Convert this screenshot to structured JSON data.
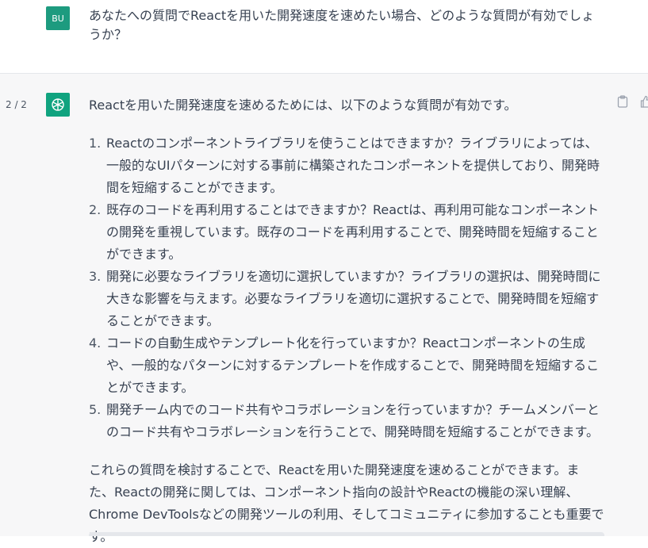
{
  "user": {
    "avatar_initials": "BU",
    "message": "あなたへの質問でReactを用いた開発速度を速めたい場合、どのような質問が有効でしょうか？"
  },
  "assistant": {
    "pager": "2 / 2",
    "intro": "Reactを用いた開発速度を速めるためには、以下のような質問が有効です。",
    "items": [
      {
        "num": "1.",
        "text": "Reactのコンポーネントライブラリを使うことはできますか？ライブラリによっては、一般的なUIパターンに対する事前に構築されたコンポーネントを提供しており、開発時間を短縮することができます。"
      },
      {
        "num": "2.",
        "text": "既存のコードを再利用することはできますか？Reactは、再利用可能なコンポーネントの開発を重視しています。既存のコードを再利用することで、開発時間を短縮することができます。"
      },
      {
        "num": "3.",
        "text": "開発に必要なライブラリを適切に選択していますか？ライブラリの選択は、開発時間に大きな影響を与えます。必要なライブラリを適切に選択することで、開発時間を短縮することができます。"
      },
      {
        "num": "4.",
        "text": "コードの自動生成やテンプレート化を行っていますか？Reactコンポーネントの生成や、一般的なパターンに対するテンプレートを作成することで、開発時間を短縮することができます。"
      },
      {
        "num": "5.",
        "text": "開発チーム内でのコード共有やコラボレーションを行っていますか？チームメンバーとのコード共有やコラボレーションを行うことで、開発時間を短縮することができます。"
      }
    ],
    "conclusion": "これらの質問を検討することで、Reactを用いた開発速度を速めることができます。また、Reactの開発に関しては、コンポーネント指向の設計やReactの機能の深い理解、Chrome DevToolsなどの開発ツールの利用、そしてコミュニティに参加することも重要です。"
  },
  "icons": {
    "copy": "clipboard-icon",
    "thumbs_up": "thumbs-up-icon",
    "bot": "openai-logo-icon"
  },
  "colors": {
    "assistant_bg": "#f7f7f8",
    "user_avatar": "#1d9b7f",
    "bot_avatar": "#10a37f"
  }
}
